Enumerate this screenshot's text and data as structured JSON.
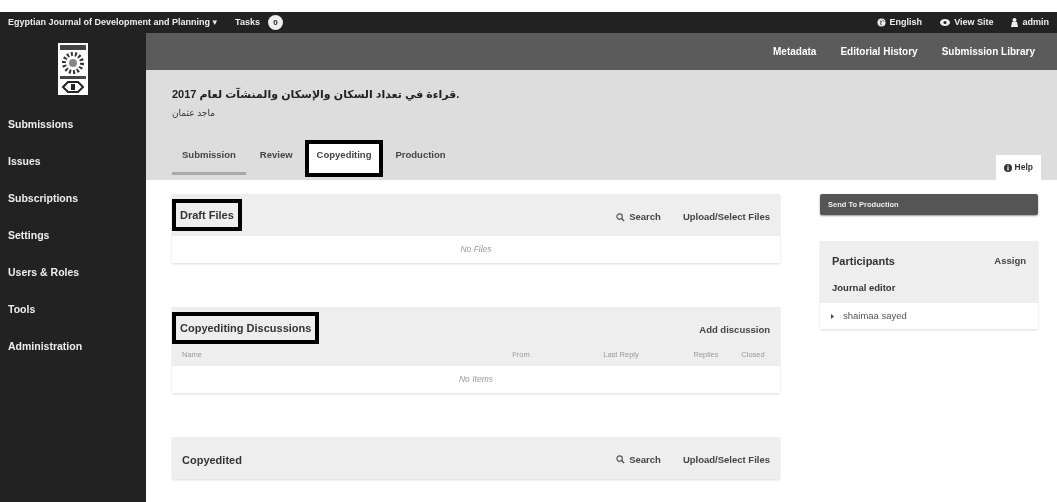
{
  "topbar": {
    "journal": "Egyptian Journal of Development and Planning",
    "journal_caret": "▾",
    "tasks_label": "Tasks",
    "tasks_count": "0",
    "links": [
      {
        "kind": "globe",
        "label": "English"
      },
      {
        "kind": "eye",
        "label": "View Site"
      },
      {
        "kind": "user",
        "label": "admin"
      }
    ]
  },
  "sidebar": {
    "items": [
      {
        "label": "Submissions"
      },
      {
        "label": "Issues"
      },
      {
        "label": "Subscriptions"
      },
      {
        "label": "Settings"
      },
      {
        "label": "Users & Roles"
      },
      {
        "label": "Tools"
      },
      {
        "label": "Administration"
      }
    ]
  },
  "header_links": [
    "Metadata",
    "Editorial History",
    "Submission Library"
  ],
  "submission": {
    "title": "قراءة في تعداد السكان والإسكان والمنشآت لعام 2017.",
    "author": "ماجد عثمان"
  },
  "tabs": [
    {
      "label": "Submission",
      "selected": true,
      "highlighted": false
    },
    {
      "label": "Review",
      "selected": false,
      "highlighted": false
    },
    {
      "label": "Copyediting",
      "selected": false,
      "highlighted": true
    },
    {
      "label": "Production",
      "selected": false,
      "highlighted": false
    }
  ],
  "help": "Help",
  "panels": [
    {
      "title": "Draft Files",
      "highlighted": true,
      "actions": [
        {
          "kind": "search",
          "label": "Search"
        },
        {
          "kind": "plain",
          "label": "Upload/Select Files"
        }
      ],
      "empty": "No Files"
    },
    {
      "title": "Copyediting Discussions",
      "highlighted": true,
      "actions": [
        {
          "kind": "plain",
          "label": "Add discussion"
        }
      ],
      "columns": [
        "Name",
        "From",
        "Last Reply",
        "Replies",
        "Closed"
      ],
      "empty": "No Items"
    },
    {
      "title": "Copyedited",
      "highlighted": false,
      "actions": [
        {
          "kind": "search",
          "label": "Search"
        },
        {
          "kind": "plain",
          "label": "Upload/Select Files"
        }
      ]
    }
  ],
  "send_button": "Send To Production",
  "participants": {
    "title": "Participants",
    "assign": "Assign",
    "groups": [
      {
        "name": "Journal editor",
        "members": [
          {
            "name": "shaimaa sayed",
            "expanded": false
          }
        ]
      }
    ]
  }
}
